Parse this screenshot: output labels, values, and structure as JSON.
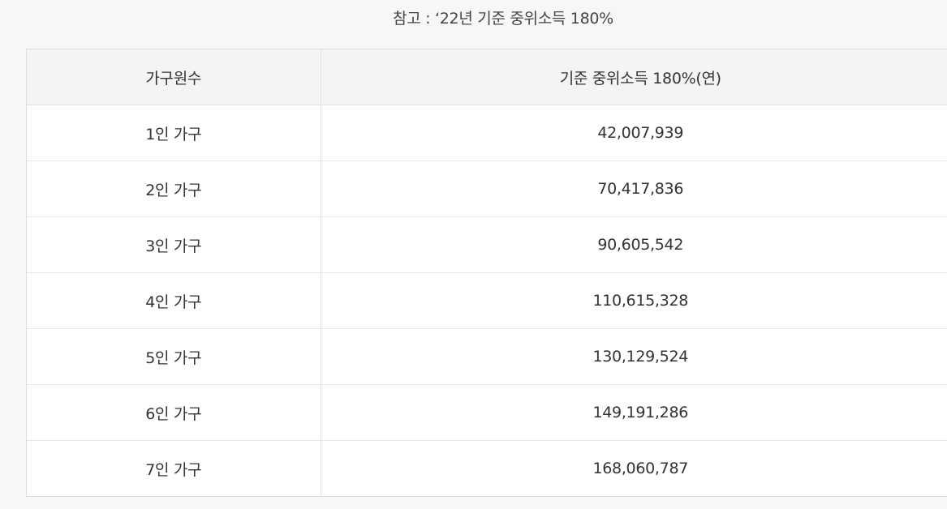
{
  "caption": "참고 : ‘22년 기준 중위소득 180%",
  "table": {
    "headers": [
      "가구원수",
      "기준 중위소득 180%(연)"
    ],
    "rows": [
      [
        "1인 가구",
        "42,007,939"
      ],
      [
        "2인 가구",
        "70,417,836"
      ],
      [
        "3인 가구",
        "90,605,542"
      ],
      [
        "4인 가구",
        "110,615,328"
      ],
      [
        "5인 가구",
        "130,129,524"
      ],
      [
        "6인 가구",
        "149,191,286"
      ],
      [
        "7인 가구",
        "168,060,787"
      ]
    ]
  }
}
